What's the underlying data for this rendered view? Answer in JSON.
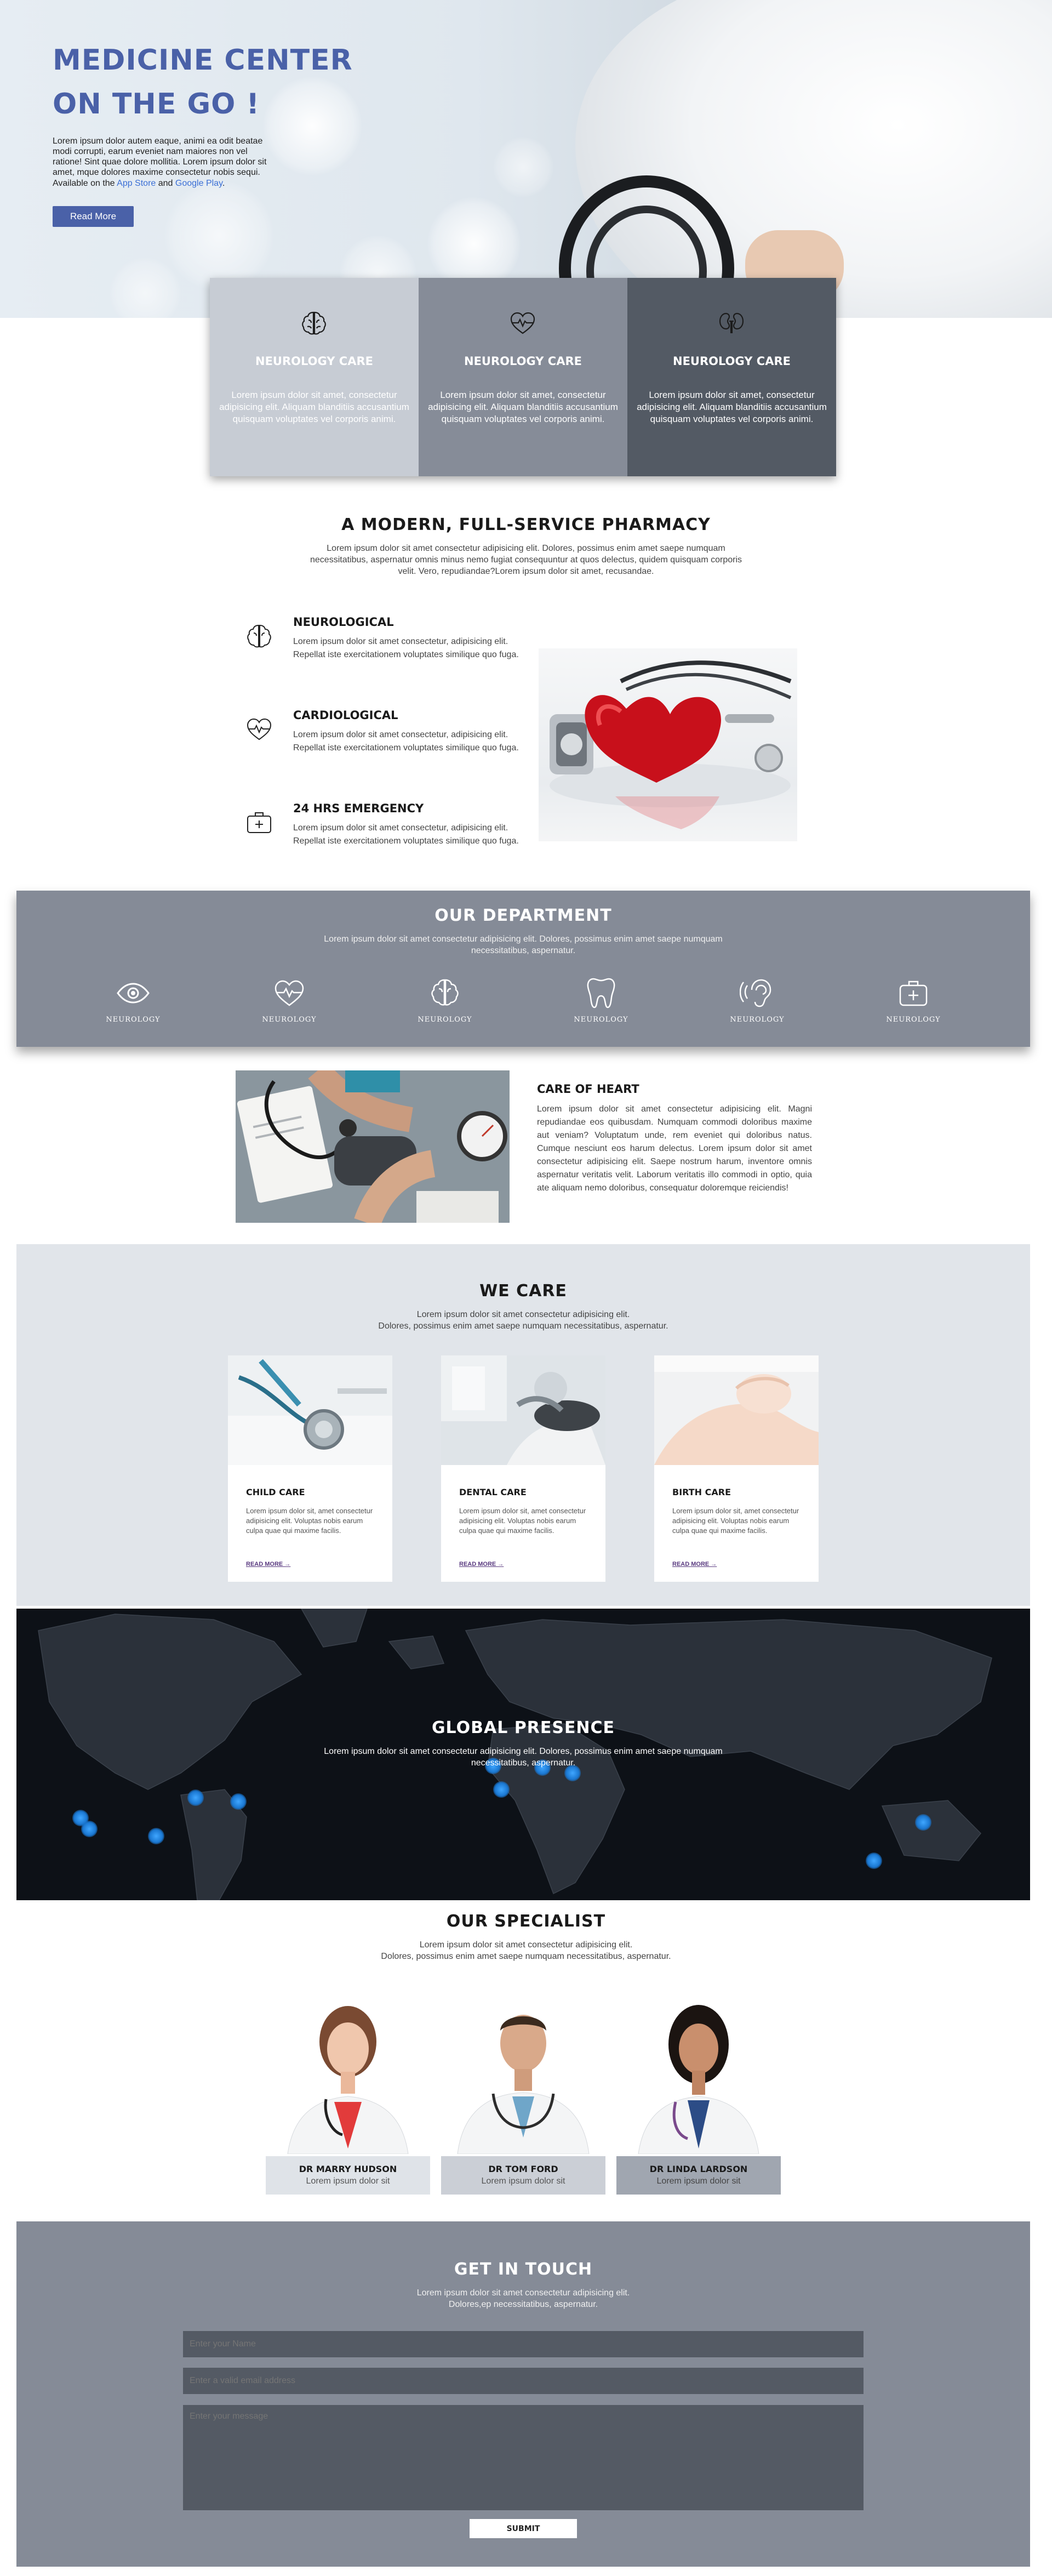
{
  "hero": {
    "title": "MEDICINE CENTER ON THE GO !",
    "text": "Lorem ipsum dolor autem eaque, animi ea odit beatae modi corrupti, earum eveniet nam maiores non vel ratione! Sint quae dolore mollitia. Lorem ipsum dolor sit amet, mque dolores maxime consectetur nobis sequi.",
    "available_prefix": "Available on the",
    "app_store": "App Store",
    "and": "and",
    "google_play": "Google Play",
    "period": ".",
    "button": "Read More"
  },
  "cards": [
    {
      "title": "NEUROLOGY CARE",
      "text": "Lorem ipsum dolor sit amet, consectetur adipisicing elit. Aliquam blanditiis accusantium quisquam voluptates vel corporis animi.",
      "bg": "#c7ccd4",
      "icon": "brain-icon"
    },
    {
      "title": "NEUROLOGY CARE",
      "text": "Lorem ipsum dolor sit amet, consectetur adipisicing elit. Aliquam blanditiis accusantium quisquam voluptates vel corporis animi.",
      "bg": "#868c98",
      "icon": "heartbeat-icon"
    },
    {
      "title": "NEUROLOGY CARE",
      "text": "Lorem ipsum dolor sit amet, consectetur adipisicing elit. Aliquam blanditiis accusantium quisquam voluptates vel corporis animi.",
      "bg": "#535a64",
      "icon": "kidneys-icon"
    }
  ],
  "pharmacy": {
    "title": "A MODERN, FULL-SERVICE PHARMACY",
    "desc": "Lorem ipsum dolor sit amet consectetur adipisicing elit. Dolores, possimus enim amet saepe numquam necessitatibus, aspernatur omnis minus nemo fugiat consequuntur at quos delectus, quidem quisquam corporis velit. Vero, repudiandae?Lorem ipsum dolor sit amet, recusandae.",
    "features": [
      {
        "title": "NEUROLOGICAL",
        "text": "Lorem ipsum dolor sit amet consectetur, adipisicing elit. Repellat iste exercitationem voluptates similique quo fuga.",
        "icon": "brain-icon"
      },
      {
        "title": "CARDIOLOGICAL",
        "text": "Lorem ipsum dolor sit amet consectetur, adipisicing elit. Repellat iste exercitationem voluptates similique quo fuga.",
        "icon": "heartbeat-icon"
      },
      {
        "title": "24 HRS EMERGENCY",
        "text": "Lorem ipsum dolor sit amet consectetur, adipisicing elit. Repellat iste exercitationem voluptates similique quo fuga.",
        "icon": "first-aid-kit-icon"
      }
    ]
  },
  "department": {
    "title": "OUR DEPARTMENT",
    "desc": "Lorem ipsum dolor sit amet consectetur adipisicing elit. Dolores, possimus enim amet saepe numquam necessitatibus, aspernatur.",
    "items": [
      {
        "label": "NEUROLOGY",
        "icon": "eye-icon"
      },
      {
        "label": "NEUROLOGY",
        "icon": "heartbeat-icon"
      },
      {
        "label": "NEUROLOGY",
        "icon": "brain-icon"
      },
      {
        "label": "NEUROLOGY",
        "icon": "tooth-icon"
      },
      {
        "label": "NEUROLOGY",
        "icon": "ear-icon"
      },
      {
        "label": "NEUROLOGY",
        "icon": "medical-kit-icon"
      }
    ]
  },
  "care_of_heart": {
    "title": "CARE OF HEART",
    "text": "Lorem ipsum dolor sit amet consectetur adipisicing elit. Magni repudiandae eos quibusdam. Numquam commodi doloribus maxime aut veniam? Voluptatum unde, rem eveniet qui doloribus natus. Cumque nesciunt eos harum delectus. Lorem ipsum dolor sit amet consectetur adipisicing elit. Saepe nostrum harum, inventore omnis aspernatur veritatis velit. Laborum veritatis illo commodi in optio, quia ate aliquam nemo doloribus, consequatur doloremque reiciendis!"
  },
  "we_care": {
    "title": "WE CARE",
    "desc_line1": "Lorem ipsum dolor sit amet consectetur adipisicing elit.",
    "desc_line2": "Dolores, possimus enim amet saepe numquam necessitatibus, aspernatur.",
    "cards": [
      {
        "title": "CHILD CARE",
        "text": "Lorem ipsum dolor sit, amet consectetur adipisicing elit. Voluptas nobis earum culpa quae qui maxime facilis.",
        "link": "READ MORE →"
      },
      {
        "title": "DENTAL CARE",
        "text": "Lorem ipsum dolor sit, amet consectetur adipisicing elit. Voluptas nobis earum culpa quae qui maxime facilis.",
        "link": "READ MORE →"
      },
      {
        "title": "BIRTH CARE",
        "text": "Lorem ipsum dolor sit, amet consectetur adipisicing elit. Voluptas nobis earum culpa quae qui maxime facilis.",
        "link": "READ MORE →"
      }
    ]
  },
  "global": {
    "title": "GLOBAL PRESENCE",
    "desc": "Lorem ipsum dolor sit amet consectetur adipisicing elit. Dolores, possimus enim amet saepe numquam necessitatibus, aspernatur.",
    "dot_color": "#1a77d1"
  },
  "specialist": {
    "title": "OUR SPECIALIST",
    "desc_line1": "Lorem ipsum dolor sit amet consectetur adipisicing elit.",
    "desc_line2": "Dolores, possimus enim amet saepe numquam necessitatibus, aspernatur.",
    "doctors": [
      {
        "name": "DR MARRY HUDSON",
        "role": "Lorem ipsum dolor sit",
        "bg": "#dfe3e8"
      },
      {
        "name": "DR TOM FORD",
        "role": "Lorem ipsum dolor sit",
        "bg": "#cbcfd6"
      },
      {
        "name": "DR LINDA LARDSON",
        "role": "Lorem ipsum dolor sit",
        "bg": "#a0a6b0"
      }
    ]
  },
  "contact": {
    "title": "GET IN TOUCH",
    "desc_line1": "Lorem ipsum dolor sit amet consectetur adipisicing elit.",
    "desc_line2": "Dolores,ep necessitatibus, aspernatur.",
    "name_placeholder": "Enter your Name",
    "email_placeholder": "Enter a valid email address",
    "message_placeholder": "Enter your message",
    "submit": "SUBMIT"
  },
  "colors": {
    "brand": "#4a61a8",
    "section_gray": "#858b97",
    "light_section": "#e1e5ea",
    "input_bg": "#545a64"
  }
}
